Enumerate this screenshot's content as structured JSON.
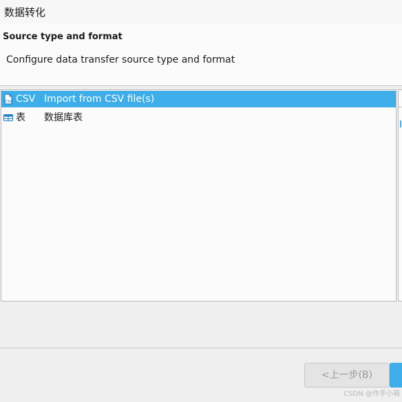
{
  "window": {
    "title": "数据转化"
  },
  "header": {
    "section_title": "Source type and format",
    "description": "Configure data transfer source type and format"
  },
  "source_list": {
    "items": [
      {
        "icon": "csv-file-icon",
        "name": "CSV",
        "description": "Import from CSV file(s)",
        "selected": true
      },
      {
        "icon": "table-icon",
        "name": "表",
        "description": "数据库表",
        "selected": false
      }
    ]
  },
  "footer": {
    "back_label": "<上一步(B)",
    "back_enabled": false
  },
  "watermark": "CSDN @作手小萌",
  "colors": {
    "selection": "#3daee9",
    "window_background": "#efefef",
    "panel_background": "#fbfbfb"
  }
}
